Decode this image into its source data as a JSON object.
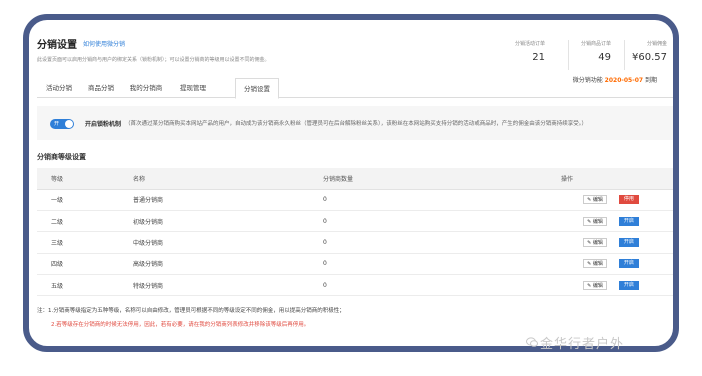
{
  "header": {
    "title": "分销设置",
    "link": "如何使用微分销",
    "description": "此设置页面可以启用分销商与用户的绑定关系（锁粉机制）；可以设置分销商的等级用以设置不同的佣金。"
  },
  "stats": [
    {
      "label": "分销活动订单",
      "value": "21"
    },
    {
      "label": "分销商品订单",
      "value": "49"
    },
    {
      "label": "分销佣金",
      "value": "¥60.57"
    }
  ],
  "vip": {
    "prefix": "微分销功能",
    "date": "2020-05-07",
    "suffix": "到期"
  },
  "tabs": [
    {
      "label": "活动分销"
    },
    {
      "label": "商品分销"
    },
    {
      "label": "我的分销商"
    },
    {
      "label": "提现管理"
    },
    {
      "label": "分销设置"
    }
  ],
  "toggle": {
    "state": "on",
    "state_label": "开",
    "label": "开启锁粉机制",
    "description": "（首次通过某分销商购买本网站产品的用户，自动成为该分销商永久粉丝（管理员可在后台解除粉丝关系），该粉丝在本网站购买支持分销的活动或商品时，产生的佣金由该分销商持续享受。）"
  },
  "levels_section": {
    "title": "分销商等级设置",
    "columns": [
      "等级",
      "名称",
      "分销商数量",
      "操作"
    ],
    "rows": [
      {
        "level": "一级",
        "name": "普通分销商",
        "count": "0",
        "edit": "编辑",
        "action": "停用",
        "action_color": "red"
      },
      {
        "level": "二级",
        "name": "初级分销商",
        "count": "0",
        "edit": "编辑",
        "action": "开启",
        "action_color": "blue"
      },
      {
        "level": "三级",
        "name": "中级分销商",
        "count": "0",
        "edit": "编辑",
        "action": "开启",
        "action_color": "blue"
      },
      {
        "level": "四级",
        "name": "高级分销商",
        "count": "0",
        "edit": "编辑",
        "action": "开启",
        "action_color": "blue"
      },
      {
        "level": "五级",
        "name": "特级分销商",
        "count": "0",
        "edit": "编辑",
        "action": "开启",
        "action_color": "blue"
      }
    ]
  },
  "notes": {
    "note1": "注：1.分销商等级指定为五种等级，名称可以自由修改，管理员可根据不同的等级设定不同的佣金，用以提高分销商的积极性；",
    "note2": "2.若等级存在分销商的时候无法停用，因此，若有必要，请在我的分销商列表修改并移除该等级后再停用。"
  },
  "watermark": "金华行者户外",
  "colors": {
    "accent": "#2f7fd8",
    "danger": "#e04a3f",
    "date": "#ff6a00",
    "frame": "#4a5b8a"
  }
}
